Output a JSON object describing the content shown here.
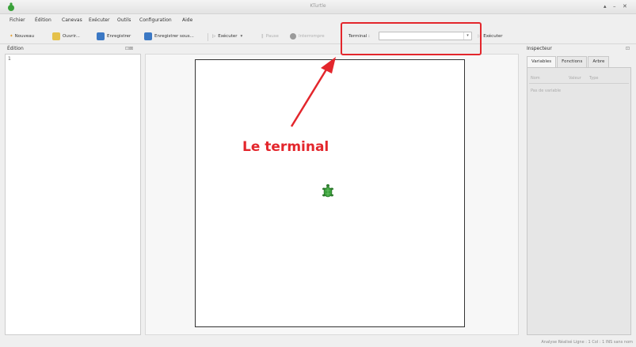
{
  "window": {
    "title": "KTurtle"
  },
  "menu": [
    "Fichier",
    "Édition",
    "Canevas",
    "Exécuter",
    "Outils",
    "Configuration",
    "Aide"
  ],
  "toolbar": {
    "new_label": "Nouveau",
    "open_label": "Ouvrir...",
    "save_label": "Enregistrer",
    "saveas_label": "Enregistrer sous...",
    "run_label": "Exécuter",
    "pause_label": "Pause",
    "stop_label": "Interrompre",
    "terminal_label": "Terminal :",
    "terminal_value": "",
    "execute_label": "Exécuter"
  },
  "editor": {
    "title": "Édition",
    "line_number": "1"
  },
  "inspector": {
    "title": "Inspecteur",
    "tabs": [
      "Variables",
      "Fonctions",
      "Arbre"
    ],
    "columns": [
      "Nom",
      "Valeur",
      "Type"
    ],
    "empty_text": "Pas de variable"
  },
  "annotation": {
    "text": "Le terminal",
    "color": "#e3262c"
  },
  "status": {
    "text": "Analyse Réalisé    Ligne : 1 Col : 1    INS    sans nom"
  },
  "colors": {
    "accent": "#e3262c",
    "turtle": "#3aa13a"
  }
}
